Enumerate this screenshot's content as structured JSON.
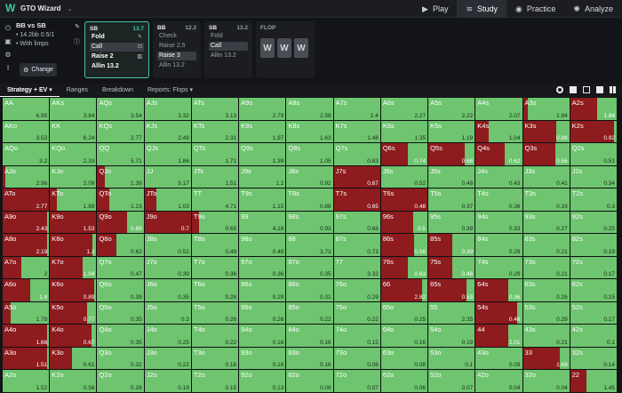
{
  "app": {
    "name": "GTO Wizard"
  },
  "nav": [
    {
      "label": "Play",
      "icon": "play-icon"
    },
    {
      "label": "Study",
      "icon": "study-icon",
      "active": true
    },
    {
      "label": "Practice",
      "icon": "gamepad-icon"
    },
    {
      "label": "Analyze",
      "icon": "bulb-icon"
    }
  ],
  "selector": {
    "title": "BB vs SB",
    "stack": "14.2bb 0.5/1",
    "mode": "With limps",
    "change_label": "Change"
  },
  "nodes": [
    {
      "pos": "SB",
      "pot": "13.7",
      "active": true,
      "actions": [
        {
          "label": "Fold",
          "style": "strong",
          "icon": "pencil-icon"
        },
        {
          "label": "Call",
          "style": "hl",
          "icon": "lock-icon"
        },
        {
          "label": "Raise 2",
          "style": "strong",
          "icon": "book-icon"
        },
        {
          "label": "Allin 13.2",
          "style": "strong"
        }
      ]
    },
    {
      "pos": "BB",
      "pot": "12.2",
      "actions": [
        {
          "label": "Check"
        },
        {
          "label": "Raise 2.5"
        },
        {
          "label": "Raise 3",
          "style": "hl"
        },
        {
          "label": "Allin 13.2"
        }
      ]
    },
    {
      "pos": "SB",
      "pot": "13.2",
      "actions": [
        {
          "label": "Fold"
        },
        {
          "label": "Call",
          "style": "hl"
        },
        {
          "label": "Allin 13.2"
        }
      ]
    }
  ],
  "flop": {
    "title": "FLOP",
    "cards": [
      "W",
      "W",
      "W"
    ]
  },
  "toolbar": {
    "tabs": [
      "Strategy + EV",
      "Ranges",
      "Breakdown",
      "Reports: Flops"
    ]
  },
  "colors": {
    "call": "#6ec46f",
    "allin": "#8e1b1d",
    "accent": "#41c7a5"
  },
  "matrix": [
    [
      [
        "AA",
        "6.95",
        0
      ],
      [
        "AKs",
        "3.84",
        0
      ],
      [
        "AQs",
        "3.54",
        0
      ],
      [
        "AJs",
        "3.32",
        0
      ],
      [
        "ATs",
        "3.13",
        0
      ],
      [
        "A9s",
        "2.79",
        0
      ],
      [
        "A8s",
        "2.58",
        0
      ],
      [
        "A7s",
        "2.4",
        0
      ],
      [
        "A6s",
        "2.27",
        0
      ],
      [
        "A5s",
        "2.22",
        0
      ],
      [
        "A4s",
        "2.07",
        0
      ],
      [
        "A3s",
        "1.94",
        0.1
      ],
      [
        "A2s",
        "1.84",
        0.58
      ]
    ],
    [
      [
        "AKo",
        "3.53",
        0
      ],
      [
        "KK",
        "6.24",
        0
      ],
      [
        "KQs",
        "2.77",
        0
      ],
      [
        "KJs",
        "2.49",
        0
      ],
      [
        "KTs",
        "2.31",
        0
      ],
      [
        "K9s",
        "1.97",
        0
      ],
      [
        "K8s",
        "1.63",
        0
      ],
      [
        "K7s",
        "1.48",
        0
      ],
      [
        "K6s",
        "1.35",
        0
      ],
      [
        "K5s",
        "1.19",
        0
      ],
      [
        "K4s",
        "1.04",
        0.28
      ],
      [
        "K3s",
        "0.98",
        0.72
      ],
      [
        "K2s",
        "0.92",
        0.95
      ]
    ],
    [
      [
        "AQo",
        "3.2",
        0
      ],
      [
        "KQo",
        "2.33",
        0
      ],
      [
        "QQ",
        "5.71",
        0
      ],
      [
        "QJs",
        "1.86",
        0
      ],
      [
        "QTs",
        "1.71",
        0
      ],
      [
        "Q9s",
        "1.39",
        0
      ],
      [
        "Q8s",
        "1.05",
        0
      ],
      [
        "Q7s",
        "0.83",
        0
      ],
      [
        "Q6s",
        "0.74",
        0.58
      ],
      [
        "Q5s",
        "0.68",
        0.78
      ],
      [
        "Q4s",
        "0.62",
        0.62
      ],
      [
        "Q3s",
        "0.56",
        0.7
      ],
      [
        "Q2s",
        "0.51",
        0
      ]
    ],
    [
      [
        "AJo",
        "2.96",
        0.05
      ],
      [
        "KJo",
        "2.09",
        0
      ],
      [
        "QJo",
        "1.39",
        0.17
      ],
      [
        "JJ",
        "5.17",
        0
      ],
      [
        "JTs",
        "1.51",
        0
      ],
      [
        "J9s",
        "1.2",
        0
      ],
      [
        "J8s",
        "0.92",
        0
      ],
      [
        "J7s",
        "0.67",
        1
      ],
      [
        "J6s",
        "0.52",
        0
      ],
      [
        "J5s",
        "0.48",
        0
      ],
      [
        "J4s",
        "0.43",
        0
      ],
      [
        "J3s",
        "0.41",
        0
      ],
      [
        "J2s",
        "0.34",
        0
      ]
    ],
    [
      [
        "ATo",
        "2.77",
        1
      ],
      [
        "KTo",
        "1.89",
        0.15
      ],
      [
        "QTo",
        "1.23",
        0.25
      ],
      [
        "JTo",
        "1.03",
        0.25
      ],
      [
        "TT",
        "4.71",
        0
      ],
      [
        "T9s",
        "1.15",
        0
      ],
      [
        "T8s",
        "0.88",
        0
      ],
      [
        "T7s",
        "0.65",
        1
      ],
      [
        "T6s",
        "0.48",
        1
      ],
      [
        "T5s",
        "0.37",
        0
      ],
      [
        "T4s",
        "0.36",
        0
      ],
      [
        "T3s",
        "0.33",
        0
      ],
      [
        "T2s",
        "0.3",
        0
      ]
    ],
    [
      [
        "A9o",
        "2.43",
        0.95
      ],
      [
        "K9o",
        "1.53",
        1
      ],
      [
        "Q9o",
        "0.89",
        0.65
      ],
      [
        "J9o",
        "0.7",
        1
      ],
      [
        "T9o",
        "0.65",
        0.15
      ],
      [
        "99",
        "4.18",
        0
      ],
      [
        "98s",
        "0.93",
        0
      ],
      [
        "97s",
        "0.68",
        0
      ],
      [
        "96s",
        "0.5",
        0.7
      ],
      [
        "95s",
        "0.39",
        0
      ],
      [
        "94s",
        "0.33",
        0
      ],
      [
        "93s",
        "0.27",
        0
      ],
      [
        "92s",
        "0.25",
        0
      ]
    ],
    [
      [
        "A8o",
        "2.19",
        0.95
      ],
      [
        "K8o",
        "1.2",
        0.92
      ],
      [
        "Q8o",
        "0.62",
        0.42
      ],
      [
        "J8o",
        "0.52",
        0
      ],
      [
        "T8o",
        "0.49",
        0
      ],
      [
        "98o",
        "0.48",
        0
      ],
      [
        "88",
        "3.73",
        0
      ],
      [
        "87s",
        "0.73",
        0
      ],
      [
        "86s",
        "0.56",
        0.72
      ],
      [
        "85s",
        "0.39",
        0.52
      ],
      [
        "84s",
        "0.29",
        0
      ],
      [
        "83s",
        "0.21",
        0
      ],
      [
        "82s",
        "0.19",
        0
      ]
    ],
    [
      [
        "A7o",
        "2",
        0.4
      ],
      [
        "K7o",
        "1.04",
        0.7
      ],
      [
        "Q7o",
        "0.47",
        0
      ],
      [
        "J7o",
        "0.39",
        0
      ],
      [
        "T7o",
        "0.36",
        0
      ],
      [
        "97o",
        "0.36",
        0
      ],
      [
        "87o",
        "0.35",
        0
      ],
      [
        "77",
        "3.32",
        0
      ],
      [
        "76s",
        "0.63",
        0.58
      ],
      [
        "75s",
        "0.46",
        0.52
      ],
      [
        "74s",
        "0.29",
        0
      ],
      [
        "73s",
        "0.21",
        0
      ],
      [
        "72s",
        "0.17",
        0
      ]
    ],
    [
      [
        "A6o",
        "1.8",
        0.6
      ],
      [
        "K6o",
        "0.89",
        0.95
      ],
      [
        "Q6o",
        "0.39",
        0
      ],
      [
        "J6o",
        "0.35",
        0
      ],
      [
        "T6o",
        "0.28",
        0
      ],
      [
        "96o",
        "0.29",
        0
      ],
      [
        "86o",
        "0.31",
        0
      ],
      [
        "76o",
        "0.29",
        0
      ],
      [
        "66",
        "2.82",
        0.88
      ],
      [
        "65s",
        "0.53",
        0.82
      ],
      [
        "64s",
        "0.36",
        0.7
      ],
      [
        "63s",
        "0.26",
        0
      ],
      [
        "62s",
        "0.15",
        0
      ]
    ],
    [
      [
        "A5o",
        "1.78",
        0.17
      ],
      [
        "K5o",
        "0.77",
        0.8
      ],
      [
        "Q5o",
        "0.35",
        0
      ],
      [
        "J5o",
        "0.3",
        0
      ],
      [
        "T5o",
        "0.26",
        0
      ],
      [
        "95o",
        "0.26",
        0
      ],
      [
        "85o",
        "0.22",
        0
      ],
      [
        "75o",
        "0.22",
        0
      ],
      [
        "65o",
        "0.25",
        0
      ],
      [
        "55",
        "2.35",
        0
      ],
      [
        "54s",
        "0.46",
        0.9
      ],
      [
        "53s",
        "0.29",
        0
      ],
      [
        "52s",
        "0.17",
        0
      ]
    ],
    [
      [
        "A4o",
        "1.66",
        0.95
      ],
      [
        "K4o",
        "0.67",
        0.9
      ],
      [
        "Q4o",
        "0.35",
        0
      ],
      [
        "J4o",
        "0.25",
        0
      ],
      [
        "T4o",
        "0.22",
        0
      ],
      [
        "94o",
        "0.18",
        0
      ],
      [
        "84o",
        "0.16",
        0
      ],
      [
        "74o",
        "0.15",
        0
      ],
      [
        "64o",
        "0.16",
        0
      ],
      [
        "54o",
        "0.19",
        0
      ],
      [
        "44",
        "2.01",
        0.7
      ],
      [
        "43s",
        "0.21",
        0
      ],
      [
        "42s",
        "0.1",
        0
      ]
    ],
    [
      [
        "A3o",
        "1.51",
        0.95
      ],
      [
        "K3o",
        "0.61",
        0.47
      ],
      [
        "Q3o",
        "0.32",
        0
      ],
      [
        "J3o",
        "0.22",
        0
      ],
      [
        "T3o",
        "0.18",
        0
      ],
      [
        "93o",
        "0.16",
        0
      ],
      [
        "83o",
        "0.16",
        0
      ],
      [
        "73o",
        "0.08",
        0
      ],
      [
        "63o",
        "0.08",
        0
      ],
      [
        "53o",
        "0.1",
        0
      ],
      [
        "43o",
        "0.09",
        0
      ],
      [
        "33",
        "1.69",
        0.8
      ],
      [
        "32s",
        "0.14",
        0
      ]
    ],
    [
      [
        "A2o",
        "1.52",
        0
      ],
      [
        "K2o",
        "0.56",
        0
      ],
      [
        "Q2o",
        "0.28",
        0
      ],
      [
        "J2o",
        "0.19",
        0
      ],
      [
        "T2o",
        "0.15",
        0
      ],
      [
        "92o",
        "0.13",
        0
      ],
      [
        "82o",
        "0.08",
        0
      ],
      [
        "72o",
        "0.07",
        0
      ],
      [
        "62o",
        "0.06",
        0
      ],
      [
        "52o",
        "0.07",
        0
      ],
      [
        "42o",
        "0.04",
        0
      ],
      [
        "32o",
        "0.04",
        0
      ],
      [
        "22",
        "1.45",
        0.35
      ]
    ]
  ]
}
